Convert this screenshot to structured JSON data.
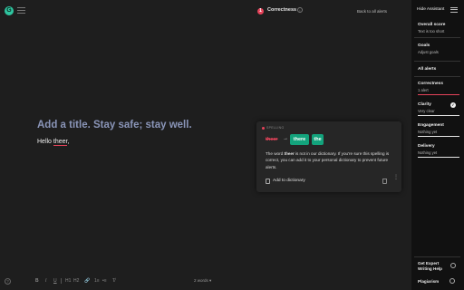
{
  "header": {
    "logo_letter": "G",
    "alert_count": "1",
    "category_title": "Correctness",
    "info_glyph": "i",
    "back_link": "Back to all alerts"
  },
  "editor": {
    "title_placeholder": "Add a title. Stay safe; stay well.",
    "body_prefix": "Hello ",
    "body_error_word": "theer",
    "body_suffix": ","
  },
  "card": {
    "tag": "SPELLING",
    "original": "theer",
    "arrow": "→",
    "suggestions": [
      "there",
      "the"
    ],
    "explanation_pre": "The word ",
    "explanation_word": "theer",
    "explanation_post": " is not in our dictionary. If you're sure this spelling is correct, you can add it to your personal dictionary to prevent future alerts.",
    "add_dictionary": "Add to dictionary",
    "more_glyph": "⋮"
  },
  "toolbar": {
    "help_glyph": "?",
    "bold": "B",
    "italic": "I",
    "underline": "U",
    "h1": "H1",
    "h2": "H2",
    "link": "🔗",
    "ordered_list": "1≡",
    "bullet_list": "•≡",
    "clear": "T̸",
    "word_count": "2 words ▾"
  },
  "sidebar": {
    "hide_label": "Hide Assistant",
    "overall_title": "Overall score",
    "overall_sub": "Text is too short",
    "goals_title": "Goals",
    "goals_sub": "Adjust goals",
    "all_alerts": "All alerts",
    "categories": [
      {
        "title": "Correctness",
        "sub": "1 alert"
      },
      {
        "title": "Clarity",
        "sub": "Very clear"
      },
      {
        "title": "Engagement",
        "sub": "Nothing yet"
      },
      {
        "title": "Delivery",
        "sub": "Nothing yet"
      }
    ],
    "check_glyph": "✓",
    "expert_help": "Get Expert Writing Help",
    "plagiarism": "Plagiarism"
  },
  "colors": {
    "accent_green": "#13a37c",
    "alert_red": "#e6435a",
    "title_placeholder": "#8a95b8"
  }
}
